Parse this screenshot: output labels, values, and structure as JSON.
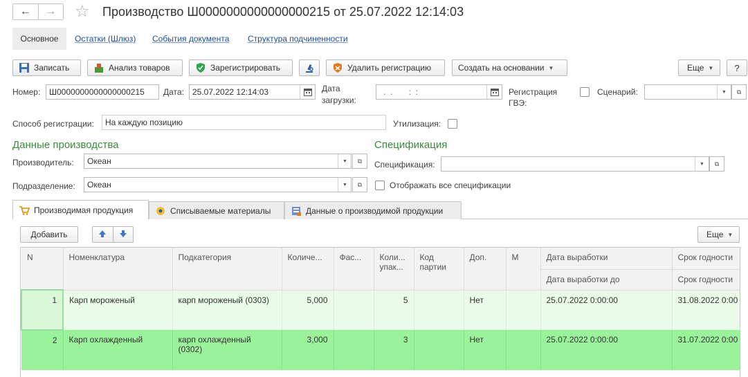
{
  "window": {
    "title": "Производство Ш0000000000000000215 от 25.07.2022 12:14:03"
  },
  "nav": {
    "items": [
      {
        "label": "Основное"
      },
      {
        "label": "Остатки (Шлюз)"
      },
      {
        "label": "События документа"
      },
      {
        "label": "Структура подчиненности"
      }
    ]
  },
  "toolbar": {
    "save_label": "Записать",
    "analysis_label": "Анализ товаров",
    "register_label": "Зарегистрировать",
    "unregister_label": "Удалить регистрацию",
    "create_based_label": "Создать на основании",
    "more_label": "Еще",
    "help_label": "?"
  },
  "header": {
    "number_label": "Номер:",
    "number_value": "Ш0000000000000000215",
    "date_label": "Дата:",
    "date_value": "25.07.2022 12:14:03",
    "load_date_label_1": "Дата",
    "load_date_label_2": "загрузки:",
    "load_date_value": ".  .       :  :",
    "gve_label_1": "Регистрация",
    "gve_label_2": "ГВЭ:",
    "scenario_label": "Сценарий:",
    "scenario_value": "",
    "reg_method_label": "Способ регистрации:",
    "reg_method_value": "На каждую позицию",
    "utilization_label": "Утилизация:"
  },
  "production": {
    "section_title": "Данные производства",
    "producer_label": "Производитель:",
    "producer_value": "Океан",
    "division_label": "Подразделение:",
    "division_value": "Океан"
  },
  "specification": {
    "section_title": "Спецификация",
    "spec_label": "Спецификация:",
    "spec_value": "",
    "show_all_label": "Отображать все спецификации"
  },
  "tabs": [
    {
      "label": "Производимая продукция"
    },
    {
      "label": "Списываемые материалы"
    },
    {
      "label": "Данные о производимой продукции"
    }
  ],
  "table_toolbar": {
    "add_label": "Добавить",
    "more_label": "Еще"
  },
  "table": {
    "headers": {
      "n": "N",
      "nomenclature": "Номенклатура",
      "subcategory": "Подкатегория",
      "quantity": "Количе...",
      "packing": "Фас...",
      "packages": "Коли... упак...",
      "batch": "Код партии",
      "additional": "Доп.",
      "m": "М",
      "prod_date": "Дата выработки",
      "prod_date_to": "Дата выработки до",
      "expiry": "Срок годности",
      "expiry2": "Срок годности"
    },
    "rows": [
      {
        "n": "1",
        "nomenclature": "Карп мороженый",
        "subcategory": "карп мороженый (0303)",
        "quantity": "5,000",
        "packing": "",
        "packages": "5",
        "batch": "",
        "additional": "Нет",
        "m": "",
        "prod_date": "25.07.2022 0:00:00",
        "expiry": "31.08.2022 0:00"
      },
      {
        "n": "2",
        "nomenclature": "Карп охлажденный",
        "subcategory": "карп охлажденный (0302)",
        "quantity": "3,000",
        "packing": "",
        "packages": "3",
        "batch": "",
        "additional": "Нет",
        "m": "",
        "prod_date": "25.07.2022 0:00:00",
        "expiry": "31.07.2022 0:00"
      }
    ]
  },
  "colors": {
    "row_light": "#eafbea",
    "row_selected": "#9af29a",
    "section_green": "#3a8a3a",
    "link_blue": "#1f4e96"
  }
}
